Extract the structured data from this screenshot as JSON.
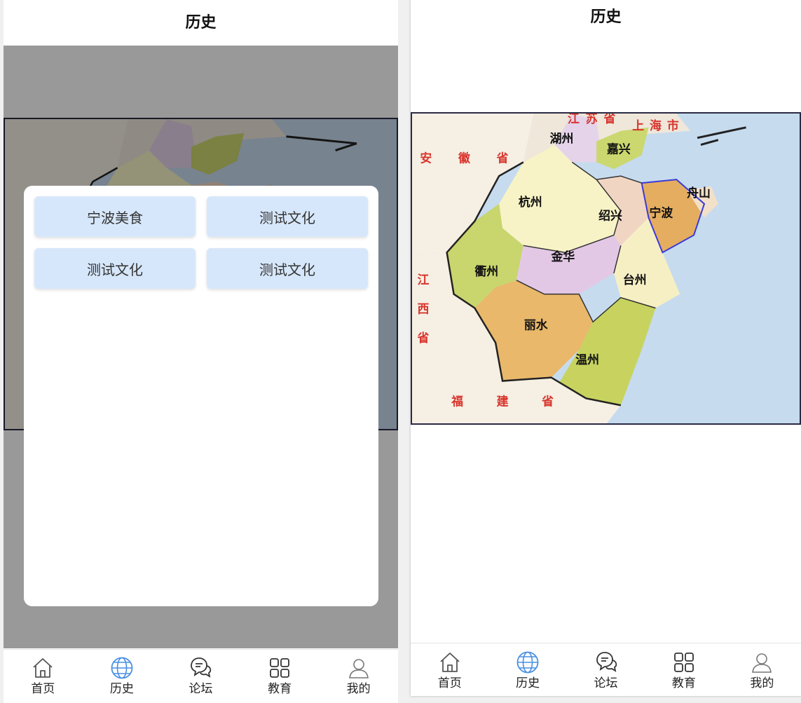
{
  "left_screen": {
    "header": {
      "title": "历史"
    },
    "modal": {
      "items": [
        {
          "label": "宁波美食"
        },
        {
          "label": "测试文化"
        },
        {
          "label": "测试文化"
        },
        {
          "label": "测试文化"
        }
      ]
    },
    "active_tab": "历史"
  },
  "right_screen": {
    "header": {
      "title": "历史"
    },
    "map": {
      "provinces": [
        "安徽省",
        "江苏省",
        "上海市",
        "江西省",
        "福建省"
      ],
      "cities": [
        "湖州",
        "嘉兴",
        "杭州",
        "绍兴",
        "宁波",
        "舟山",
        "金华",
        "衢州",
        "台州",
        "丽水",
        "温州"
      ]
    },
    "active_tab": "历史"
  },
  "tabbar": {
    "items": [
      {
        "label": "首页",
        "icon": "home-icon"
      },
      {
        "label": "历史",
        "icon": "globe-icon"
      },
      {
        "label": "论坛",
        "icon": "chat-bubbles-icon"
      },
      {
        "label": "教育",
        "icon": "grid-icon"
      },
      {
        "label": "我的",
        "icon": "user-icon"
      }
    ]
  },
  "colors": {
    "tab_active": "#4a90e2",
    "tab_inactive": "#555555",
    "modal_tile_bg": "#d7e7fb",
    "overlay": "rgba(0,0,0,0.4)",
    "sea": "#c6dbee"
  }
}
